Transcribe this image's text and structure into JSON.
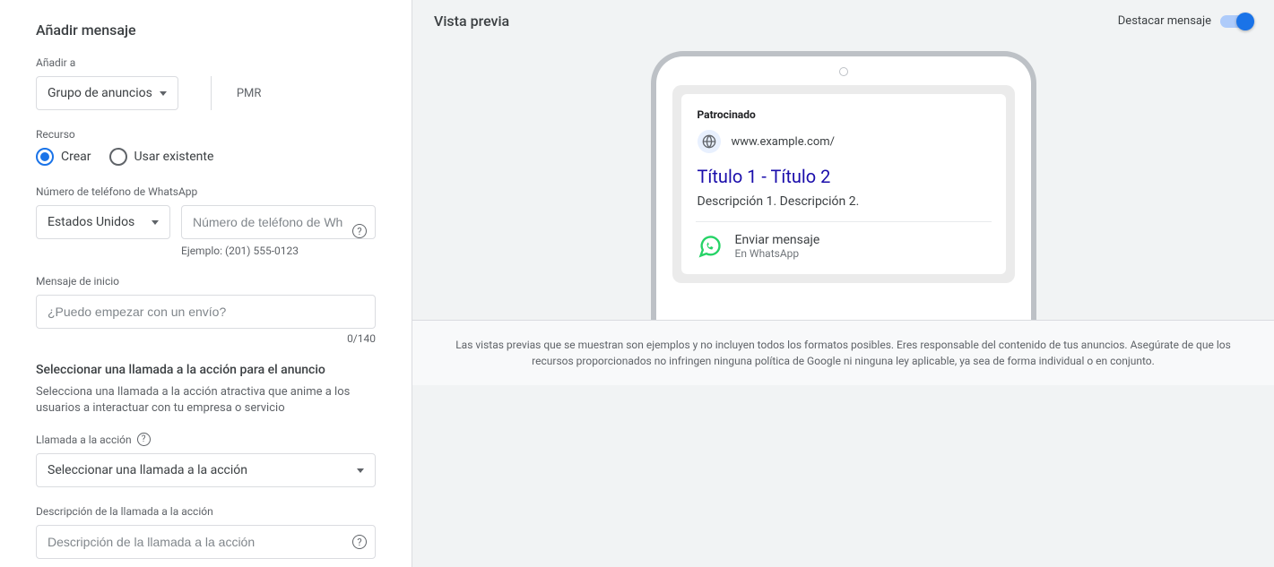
{
  "form": {
    "heading": "Añadir mensaje",
    "add_to_label": "Añadir a",
    "add_to_value": "Grupo de anuncios",
    "pmr": "PMR",
    "resource_label": "Recurso",
    "resource_create": "Crear",
    "resource_use_existing": "Usar existente",
    "phone_label": "Número de teléfono de WhatsApp",
    "country_value": "Estados Unidos",
    "phone_placeholder": "Número de teléfono de Wh…",
    "phone_hint": "Ejemplo: (201) 555-0123",
    "start_msg_label": "Mensaje de inicio",
    "start_msg_placeholder": "¿Puedo empezar con un envío?",
    "start_msg_counter": "0/140",
    "cta_heading": "Seleccionar una llamada a la acción para el anuncio",
    "cta_help": "Selecciona una llamada a la acción atractiva que anime a los usuarios a interactuar con tu empresa o servicio",
    "cta_label": "Llamada a la acción",
    "cta_placeholder": "Seleccionar una llamada a la acción",
    "cta_desc_label": "Descripción de la llamada a la acción",
    "cta_desc_placeholder": "Descripción de la llamada a la acción"
  },
  "preview": {
    "title": "Vista previa",
    "toggle_label": "Destacar mensaje",
    "sponsored": "Patrocinado",
    "url": "www.example.com/",
    "ad_title": "Título 1 - Título 2",
    "ad_desc": "Descripción 1. Descripción 2.",
    "wa_main": "Enviar mensaje",
    "wa_sub": "En WhatsApp",
    "disclaimer": "Las vistas previas que se muestran son ejemplos y no incluyen todos los formatos posibles. Eres responsable del contenido de tus anuncios. Asegúrate de que los recursos proporcionados no infringen ninguna política de Google ni ninguna ley aplicable, ya sea de forma individual o en conjunto."
  }
}
